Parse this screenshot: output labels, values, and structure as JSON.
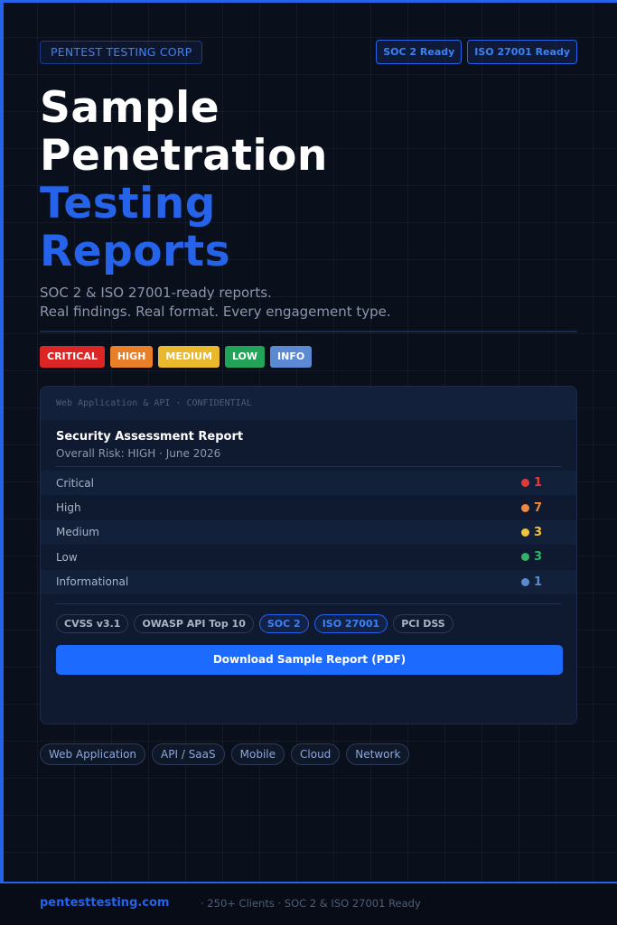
{
  "header": {
    "brand": "PENTEST TESTING CORP",
    "certifications": [
      "SOC 2 Ready",
      "ISO 27001 Ready"
    ]
  },
  "hero": {
    "title_white": [
      "Sample",
      "Penetration"
    ],
    "title_blue": [
      "Testing",
      "Reports"
    ],
    "subtitle_lines": [
      "SOC 2 & ISO 27001-ready reports.",
      "Real findings. Real format. Every engagement type."
    ]
  },
  "severity_levels": [
    {
      "label": "CRITICAL",
      "color": "#dc2626"
    },
    {
      "label": "HIGH",
      "color": "#ea7f2a"
    },
    {
      "label": "MEDIUM",
      "color": "#e9b82d"
    },
    {
      "label": "LOW",
      "color": "#22a35a"
    },
    {
      "label": "INFO",
      "color": "#5b8ad2"
    }
  ],
  "report": {
    "header_label": "Web Application & API  ·  CONFIDENTIAL",
    "title": "Security Assessment Report",
    "meta": "Overall Risk: HIGH  ·  June 2026",
    "findings": [
      {
        "label": "Critical",
        "count": "1",
        "color": "#e23a3a"
      },
      {
        "label": "High",
        "count": "7",
        "color": "#f0883e"
      },
      {
        "label": "Medium",
        "count": "3",
        "color": "#f2c23a"
      },
      {
        "label": "Low",
        "count": "3",
        "color": "#34b364"
      },
      {
        "label": "Informational",
        "count": "1",
        "color": "#5b8ad2"
      }
    ],
    "tags": [
      {
        "label": "CVSS v3.1",
        "highlight": false
      },
      {
        "label": "OWASP API Top 10",
        "highlight": false
      },
      {
        "label": "SOC 2",
        "highlight": true
      },
      {
        "label": "ISO 27001",
        "highlight": true
      },
      {
        "label": "PCI DSS",
        "highlight": false
      }
    ],
    "download_label": "Download Sample Report (PDF)"
  },
  "engagement_types": [
    "Web Application",
    "API / SaaS",
    "Mobile",
    "Cloud",
    "Network"
  ],
  "footer": {
    "domain": "pentesttesting.com",
    "info": "·  250+ Clients  ·  SOC 2 & ISO 27001 Ready"
  },
  "colors": {
    "accent": "#2563eb",
    "button": "#1d6aff",
    "background": "#0a0f1c"
  }
}
